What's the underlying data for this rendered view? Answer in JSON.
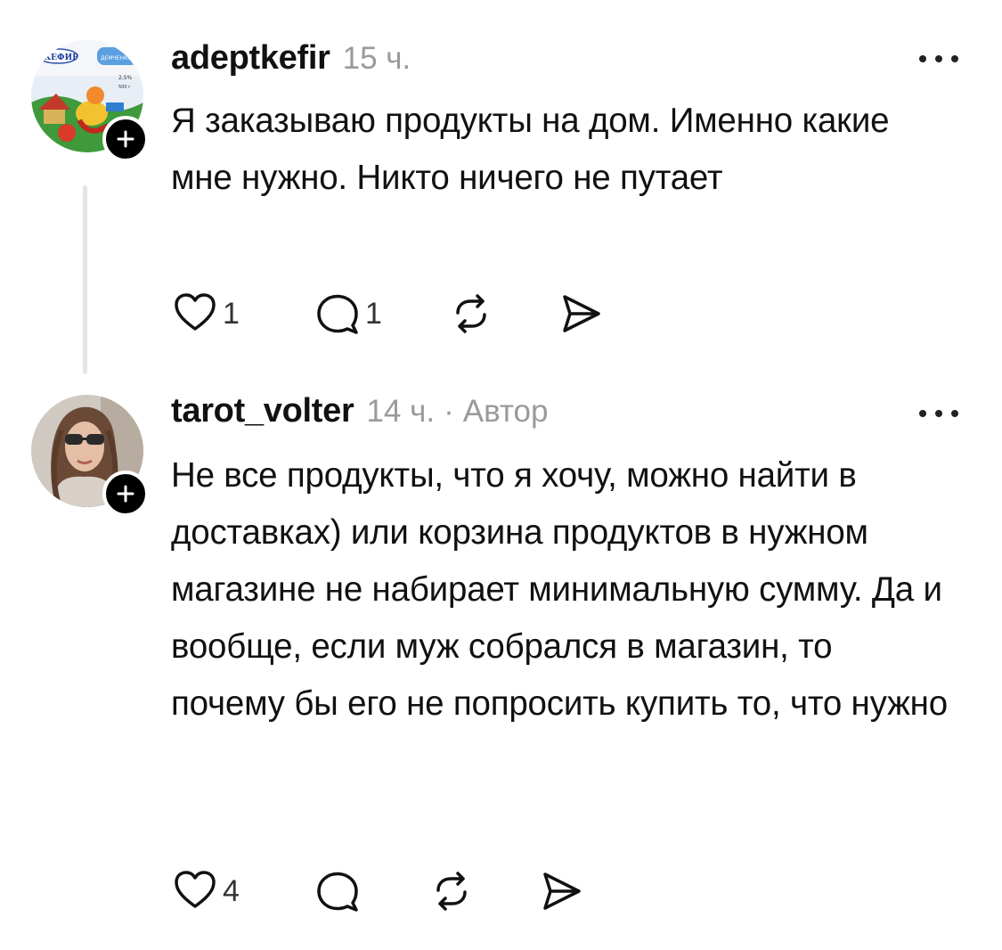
{
  "posts": [
    {
      "username": "adeptkefir",
      "time": "15 ч.",
      "author_badge": "",
      "avatar_text": [
        "КЕФИР",
        "ДЕМЧЕНКО",
        "2,5%",
        "500 г"
      ],
      "text": "Я заказываю продукты на дом. Именно какие мне нужно. Никто ничего не путает",
      "likes": "1",
      "replies": "1"
    },
    {
      "username": "tarot_volter",
      "time": "14 ч.",
      "separator": "·",
      "author_badge": "Автор",
      "text": "Не все продукты, что я хочу, можно найти в доставках) или корзина продуктов в нужном магазине не набирает минимальную сумму. Да и вообще, если муж собрался в магазин, то почему бы его не попросить купить то, что нужно",
      "likes": "4",
      "replies": ""
    }
  ],
  "icons": {
    "like": "heart-icon",
    "reply": "comment-bubble-icon",
    "repost": "repost-icon",
    "share": "send-icon",
    "more": "more-dots-icon",
    "follow": "plus-icon"
  }
}
